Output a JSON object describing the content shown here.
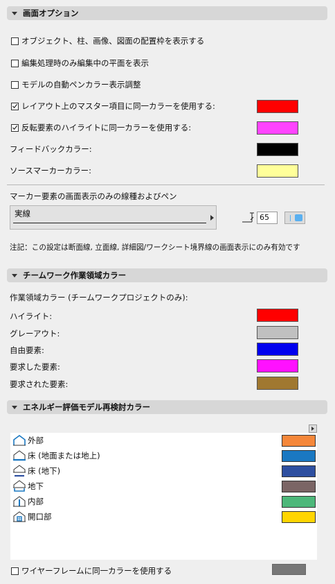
{
  "sections": {
    "display_options": "画面オプション",
    "teamwork": "チームワーク作業領域カラー",
    "energy": "エネルギー評価モデル再検討カラー"
  },
  "display": {
    "cb_bounding": {
      "label": "オブジェクト、柱、画像、図面の配置枠を表示する",
      "checked": false
    },
    "cb_edit_plane": {
      "label": "編集処理時のみ編集中の平面を表示",
      "checked": false
    },
    "cb_auto_pen": {
      "label": "モデルの自動ペンカラー表示調整",
      "checked": false
    },
    "cb_master": {
      "label": "レイアウト上のマスター項目に同一カラーを使用する:",
      "checked": true,
      "color": "#ff0000"
    },
    "cb_highlight": {
      "label": "反転要素のハイライトに同一カラーを使用する:",
      "checked": true,
      "color": "#ff44ff"
    },
    "feedback": {
      "label": "フィードバックカラー:",
      "color": "#000000"
    },
    "source_marker": {
      "label": "ソースマーカーカラー:",
      "color": "#ffff99"
    },
    "marker_title": "マーカー要素の画面表示のみの線種およびペン",
    "line_type": "実線",
    "pen_number": "65",
    "note": "注記：この設定は断面線, 立面線, 詳細図/ワークシート境界線の画面表示にのみ有効です"
  },
  "teamwork": {
    "heading": "作業領域カラー (チームワークプロジェクトのみ):",
    "items": [
      {
        "label": "ハイライト:",
        "color": "#ff0000"
      },
      {
        "label": "グレーアウト:",
        "color": "#c0c0c0"
      },
      {
        "label": "自由要素:",
        "color": "#0000ee"
      },
      {
        "label": "要求した要素:",
        "color": "#ff11ff"
      },
      {
        "label": "要求された要素:",
        "color": "#a07830"
      }
    ]
  },
  "energy": {
    "items": [
      {
        "label": "外部",
        "icon": "house-outline-icon",
        "color": "#f5873a"
      },
      {
        "label": "床 (地面または地上)",
        "icon": "house-floor-icon",
        "color": "#1a78c2"
      },
      {
        "label": "床 (地下)",
        "icon": "house-underground-floor-icon",
        "color": "#2e4fa0"
      },
      {
        "label": "地下",
        "icon": "house-underground-icon",
        "color": "#7b6565"
      },
      {
        "label": "内部",
        "icon": "house-interior-icon",
        "color": "#4db87a"
      },
      {
        "label": "開口部",
        "icon": "house-opening-icon",
        "color": "#ffd500"
      }
    ],
    "wireframe": {
      "label": "ワイヤーフレームに同一カラーを使用する",
      "checked": false,
      "color": "#777777"
    }
  }
}
